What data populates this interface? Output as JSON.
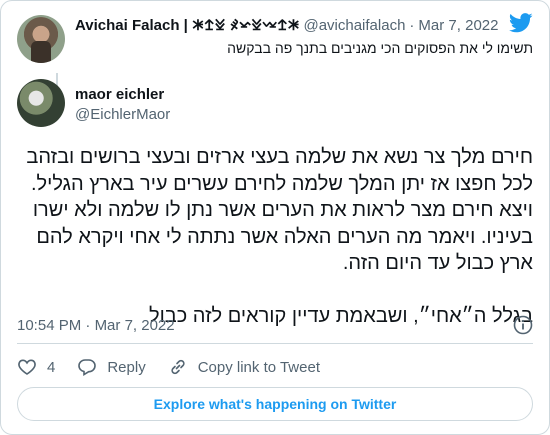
{
  "parent_tweet": {
    "author_name": "Avichai Falach | 𐠁𐠊𐠈𐠃𐠏𐠋 𐠃𐠊𐠁",
    "handle": "@avichaifalach",
    "separator": "·",
    "date": "Mar 7, 2022",
    "text": "תשימו לי את הפסוקים הכי מגניבים בתנך פה בבקשה"
  },
  "main_tweet": {
    "author_name": "maor eichler",
    "handle": "@EichlerMaor",
    "paragraphs": [
      "חירם מלך צר נשא את שלמה בעצי ארזים ובעצי ברושים ובזהב לכל חפצו אז יתן המלך שלמה לחירם עשרים עיר בארץ הגליל. ויצא חירם מצר לראות את הערים אשר נתן לו שלמה ולא ישרו בעיניו. ויאמר מה הערים האלה אשר נתתה לי אחי ויקרא להם ארץ כבול עד היום הזה.",
      "בגלל ה״אחי״, ושבאמת עדיין קוראים לזה כבול"
    ],
    "time": "10:54 PM",
    "separator": "·",
    "date": "Mar 7, 2022"
  },
  "actions": {
    "like_count": "4",
    "reply_label": "Reply",
    "copy_link_label": "Copy link to Tweet"
  },
  "explore_label": "Explore what's happening on Twitter",
  "colors": {
    "brand": "#1d9bf0",
    "text": "#0f1419",
    "muted": "#536471",
    "border": "#cfd9de"
  }
}
